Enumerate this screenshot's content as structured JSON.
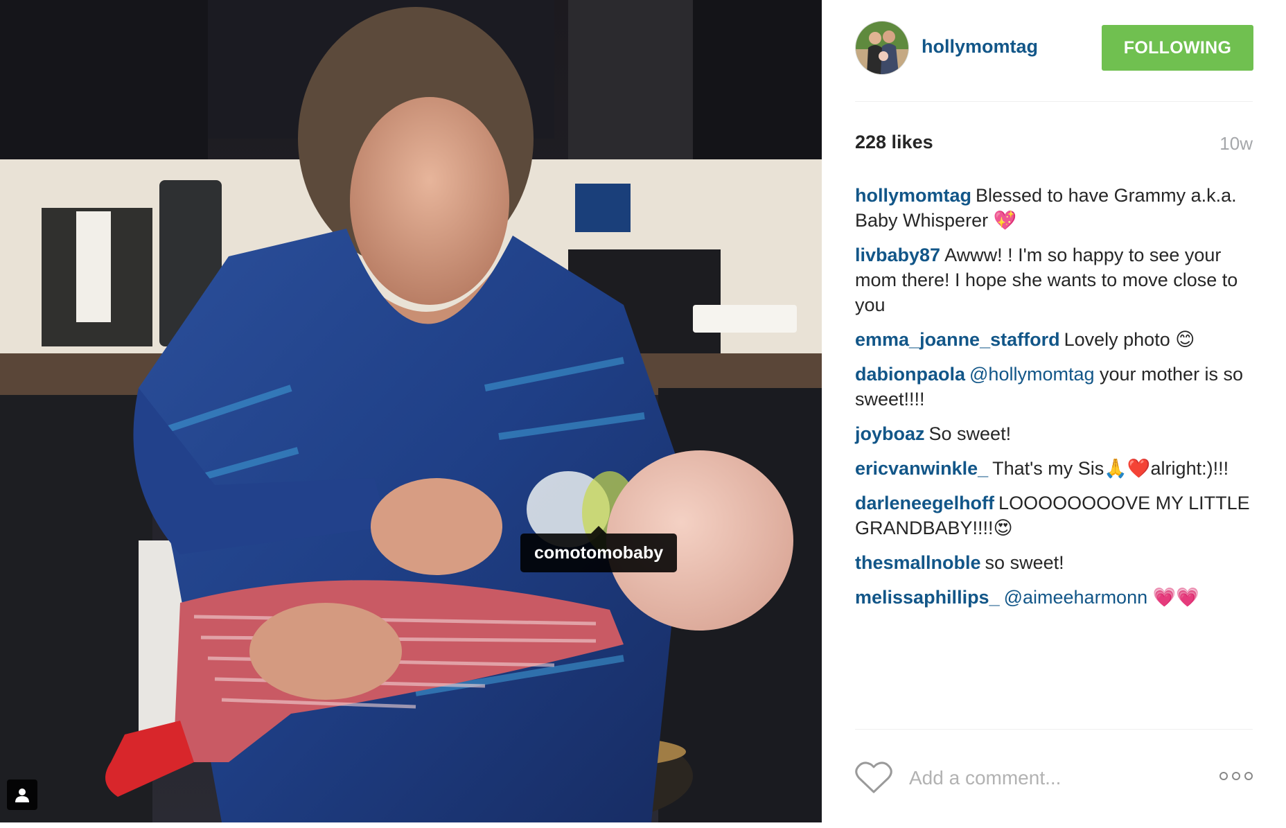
{
  "post": {
    "username": "hollymomtag",
    "follow_label": "FOLLOWING",
    "likes": "228 likes",
    "age": "10w",
    "photo_tag": "comotomobaby",
    "comment_placeholder": "Add a comment..."
  },
  "comments": [
    {
      "user": "hollymomtag",
      "parts": [
        {
          "text": "Blessed to have Grammy a.k.a. Baby Whisperer 💖"
        }
      ]
    },
    {
      "user": "livbaby87",
      "parts": [
        {
          "text": "Awww! ! I'm so happy to see your mom there! I hope she wants to move close to you"
        }
      ]
    },
    {
      "user": "emma_joanne_stafford",
      "parts": [
        {
          "text": "Lovely photo 😊"
        }
      ]
    },
    {
      "user": "dabionpaola",
      "parts": [
        {
          "text": "@hollymomtag",
          "mention": true
        },
        {
          "text": " your mother is so sweet!!!!"
        }
      ]
    },
    {
      "user": "joyboaz",
      "parts": [
        {
          "text": "So sweet!"
        }
      ]
    },
    {
      "user": "ericvanwinkle_",
      "parts": [
        {
          "text": "That's my Sis🙏❤️alright:)!!!"
        }
      ]
    },
    {
      "user": "darleneegelhoff",
      "parts": [
        {
          "text": "LOOOOOOOOVE MY LITTLE GRANDBABY!!!!😍"
        }
      ]
    },
    {
      "user": "thesmallnoble",
      "parts": [
        {
          "text": "so sweet!"
        }
      ]
    },
    {
      "user": "melissaphillips_",
      "parts": [
        {
          "text": "@aimeeharmonn",
          "mention": true
        },
        {
          "text": " 💗💗"
        }
      ]
    }
  ],
  "icons": {
    "like": "heart-outline-icon",
    "more": "more-options-icon",
    "user_tag": "person-icon"
  },
  "colors": {
    "username": "#125688",
    "follow_button": "#70c050",
    "muted": "#a5a7aa"
  }
}
